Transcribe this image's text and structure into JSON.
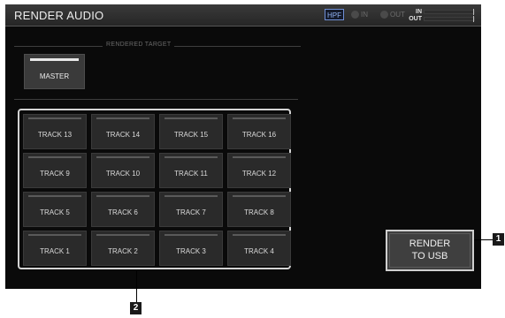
{
  "title_bar": {
    "title": "RENDER AUDIO",
    "hpf_label": "HPF",
    "in_indicator": "IN",
    "out_indicator": "OUT",
    "meter_in_label": "IN",
    "meter_out_label": "OUT"
  },
  "rendered_target": {
    "label": "RENDERED TARGET",
    "master_label": "MASTER"
  },
  "tracks": [
    [
      "TRACK 13",
      "TRACK 14",
      "TRACK 15",
      "TRACK 16"
    ],
    [
      "TRACK 9",
      "TRACK 10",
      "TRACK 11",
      "TRACK 12"
    ],
    [
      "TRACK 5",
      "TRACK 6",
      "TRACK 7",
      "TRACK 8"
    ],
    [
      "TRACK 1",
      "TRACK 2",
      "TRACK 3",
      "TRACK 4"
    ]
  ],
  "render_button": {
    "line1": "RENDER",
    "line2": "TO USB"
  },
  "callouts": {
    "c1": "1",
    "c2": "2"
  }
}
